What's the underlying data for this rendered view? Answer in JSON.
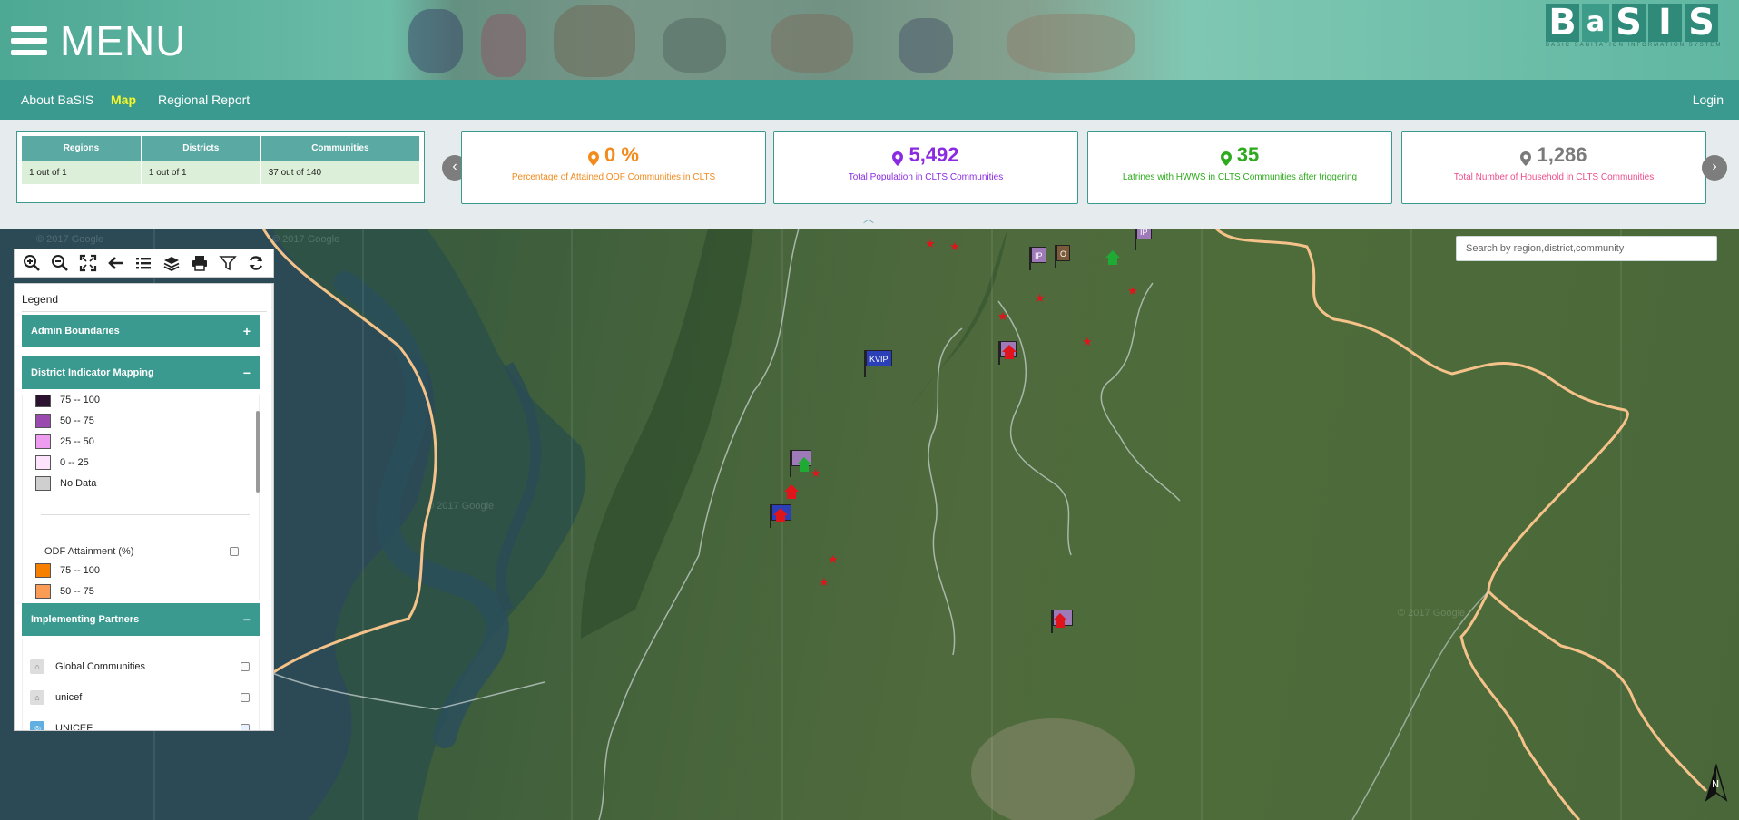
{
  "header": {
    "menu_label": "MENU",
    "logo_letters": [
      "B",
      "a",
      "S",
      "I",
      "S"
    ],
    "logo_subtitle": "BASIC SANITATION INFORMATION SYSTEM"
  },
  "nav": {
    "items": [
      {
        "label": "About BaSIS"
      },
      {
        "label": "Map"
      },
      {
        "label": "Regional Report"
      }
    ],
    "login_label": "Login"
  },
  "selection_table": {
    "headers": [
      "Regions",
      "Districts",
      "Communities"
    ],
    "values": [
      "1 out of 1",
      "1 out of 1",
      "37 out of 140"
    ]
  },
  "cards": [
    {
      "value": "0 %",
      "label": "Percentage of Attained ODF Communities in CLTS",
      "color": "#f28a1c"
    },
    {
      "value": "5,492",
      "label": "Total Population in CLTS Communities",
      "color": "#8a2be2"
    },
    {
      "value": "35",
      "label": "Latrines with HWWS in CLTS Communities after triggering",
      "color": "#2eaa1e"
    },
    {
      "value": "1,286",
      "label": "Total Number of Household in CLTS Communities",
      "color": "#ef4d8a",
      "value_color": "#7a7a7a"
    }
  ],
  "map": {
    "search_placeholder": "Search by region,district,community",
    "north_label": "N",
    "watermark": "© 2017 Google",
    "flag_labels": [
      "KVIP",
      "IP",
      "IP",
      "O"
    ]
  },
  "toolbar": {
    "tools": [
      "zoom-in-icon",
      "zoom-out-icon",
      "full-extent-icon",
      "back-icon",
      "list-icon",
      "layers-icon",
      "print-icon",
      "filter-icon",
      "refresh-icon"
    ]
  },
  "legend": {
    "title": "Legend",
    "sections": [
      {
        "label": "Admin Boundaries",
        "sign": "+"
      },
      {
        "label": "District Indicator Mapping",
        "sign": "−"
      },
      {
        "label": "Implementing Partners",
        "sign": "−"
      }
    ],
    "indicator_ranges": [
      {
        "label": "75 -- 100",
        "color": "#2b1330"
      },
      {
        "label": "50 -- 75",
        "color": "#9b4ab0"
      },
      {
        "label": "25 -- 50",
        "color": "#ee9cf0"
      },
      {
        "label": "0 -- 25",
        "color": "#fde3fb"
      },
      {
        "label": "No Data",
        "color": "#cfcfcf"
      }
    ],
    "odf_title": "ODF Attainment (%)",
    "odf_ranges": [
      {
        "label": "75 -- 100",
        "color": "#f77f00"
      },
      {
        "label": "50 -- 75",
        "color": "#fa9c55"
      }
    ],
    "partners": [
      {
        "name": "Global Communities",
        "checked": false
      },
      {
        "name": "unicef",
        "checked": false
      },
      {
        "name": "UNICEF",
        "checked": true
      }
    ]
  }
}
